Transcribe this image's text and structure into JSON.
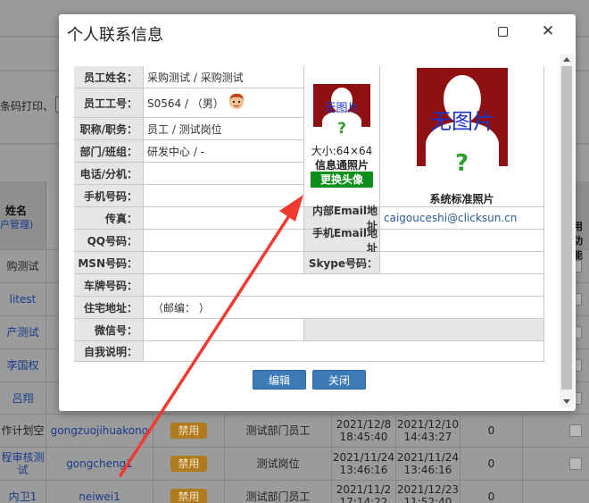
{
  "dialog": {
    "title": "个人联系信息",
    "buttons": {
      "edit": "编辑",
      "close": "关闭"
    }
  },
  "info": {
    "name_label": "员工姓名：",
    "name_value": "采购测试 / 采购测试",
    "id_label": "员工工号：",
    "id_value": "S0564 / （男）",
    "title_label": "职称/职务：",
    "title_value": "员工 / 测试岗位",
    "dept_label": "部门/班组：",
    "dept_value": "研发中心 / -",
    "phone_label": "电话/分机：",
    "phone_value": "",
    "mobile_label": "手机号码：",
    "mobile_value": "",
    "fax_label": "传真：",
    "fax_value": "",
    "qq_label": "QQ号码：",
    "qq_value": "",
    "msn_label": "MSN号码：",
    "msn_value": "",
    "plate_label": "车牌号码：",
    "plate_value": "",
    "address_label": "住宅地址：",
    "address_value": "（邮编：  ）",
    "wechat_label": "微信号：",
    "wechat_value": "",
    "about_label": "自我说明：",
    "about_value": "",
    "inner_email_label": "内部Email地址",
    "inner_email_value": "caigouceshi@clicksun.cn",
    "mobile_email_label": "手机Email地址",
    "mobile_email_value": "",
    "skype_label": "Skype号码：",
    "skype_value": ""
  },
  "photos": {
    "placeholder_text": "无图片",
    "placeholder_q": "?",
    "small_size": "大小:64×64",
    "small_caption": "信息通照片",
    "change_button": "更换头像",
    "big_caption": "系统标准照片"
  },
  "background": {
    "toolbar_text": "条码打印、",
    "col_name_header": "姓名",
    "col_name_sub": "户管理)",
    "col_right_header_1": "用",
    "col_right_header_2": "功能",
    "disabled_badge": "禁用",
    "rows_left": [
      "购测试",
      "litest",
      "产测试",
      "李国权",
      "吕翔"
    ],
    "rows": [
      {
        "name": "作计划空",
        "account": "gongzuojihuakong",
        "badge": "禁用",
        "role": "测试部门员工",
        "date1": "2021/12/8\n18:45:40",
        "date2": "2021/12/10\n14:43:27",
        "count": "0"
      },
      {
        "name": "程审核测\n试",
        "account": "gongcheng1",
        "badge": "禁用",
        "role": "测试岗位",
        "date1": "2021/11/24\n13:46:16",
        "date2": "2021/11/24\n13:46:16",
        "count": "0"
      },
      {
        "name": "内卫1",
        "account": "neiwei1",
        "badge": "禁用",
        "role": "测试部门员工",
        "date1": "2021/11/2\n17:14:22",
        "date2": "2021/12/23\n11:52:40",
        "count": "0"
      }
    ]
  },
  "colors": {
    "dim_background": "#9b9b9b",
    "label_bg": "#e6e6e6",
    "button_blue": "#3d7ab8",
    "change_button_green": "#0e8e1b",
    "photo_red": "#8e1010",
    "arrow_red": "#f03a32"
  }
}
